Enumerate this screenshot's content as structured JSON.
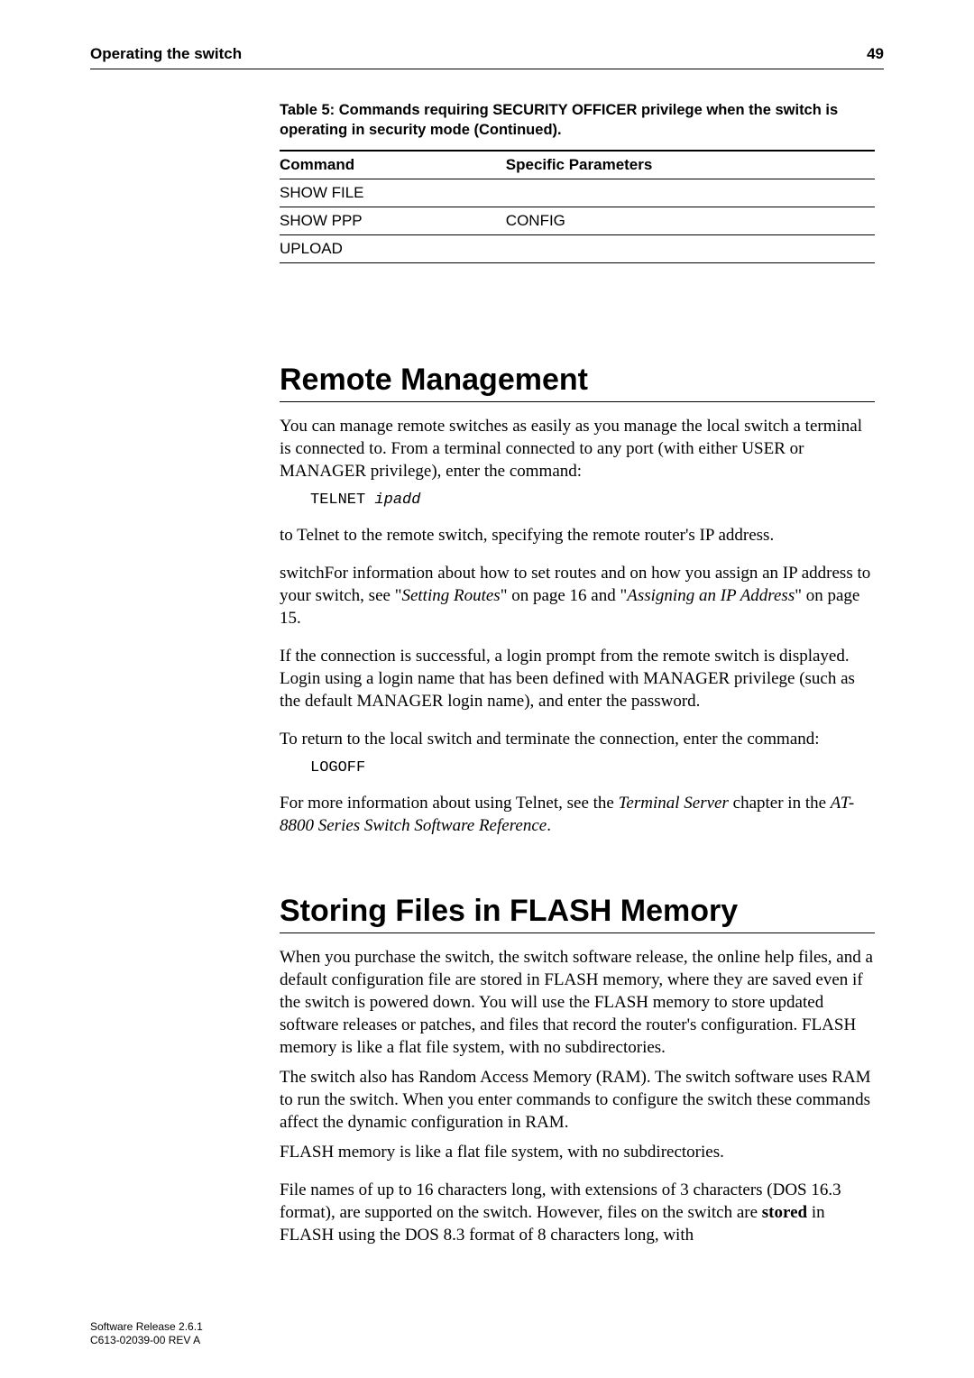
{
  "header": {
    "title": "Operating the switch",
    "page_number": "49"
  },
  "table": {
    "caption": "Table 5: Commands requiring SECURITY OFFICER privilege when the switch is operating in security mode (Continued).",
    "headers": {
      "col1": "Command",
      "col2": "Specific Parameters"
    },
    "rows": [
      {
        "command": "SHOW FILE",
        "params": ""
      },
      {
        "command": "SHOW PPP",
        "params": "CONFIG"
      },
      {
        "command": "UPLOAD",
        "params": ""
      }
    ]
  },
  "section_remote": {
    "title": "Remote Management",
    "p1": "You can manage remote switches as easily as you manage the local switch a terminal is connected to. From a terminal connected to any port (with either USER or MANAGER privilege), enter the command:",
    "cmd1_prefix": "TELNET ",
    "cmd1_arg": "ipadd",
    "p2": "to Telnet to the remote switch, specifying the remote router's IP address.",
    "p3_a": "switchFor information about how to set routes and on how you assign an IP address to your switch, see \"",
    "p3_ref1": "Setting Routes",
    "p3_b": "\" on page 16 and \"",
    "p3_ref2": "Assigning an IP Address",
    "p3_c": "\" on page 15.",
    "p4": "If the connection is successful, a login prompt from the remote switch is displayed. Login using a login name that has been defined with MANAGER privilege (such as the default MANAGER login name), and enter the password.",
    "p5": "To return to the local switch and terminate the connection, enter the command:",
    "cmd2": "LOGOFF",
    "p6_a": "For more information about using Telnet, see the ",
    "p6_ref1": "Terminal Server",
    "p6_b": " chapter in the ",
    "p6_ref2": "AT-8800 Series Switch Software Reference",
    "p6_c": "."
  },
  "section_flash": {
    "title": "Storing Files in FLASH Memory",
    "p1": "When you purchase the switch, the switch software release, the online help files, and a default configuration file are stored in FLASH memory, where they are saved even if the switch is powered down. You will use the FLASH memory to store updated software releases or patches, and files that record the router's configuration. FLASH memory is like a flat file system, with no subdirectories.",
    "p2": "The switch also has Random Access Memory (RAM). The switch software uses RAM to run the switch. When you enter commands to configure the switch these commands affect the dynamic configuration in RAM.",
    "p3": "FLASH memory is like a flat file system, with no subdirectories.",
    "p4_a": "File names of up to 16 characters long, with extensions of 3 characters (DOS 16.3 format), are supported on the switch. However, files on the switch are ",
    "p4_strong": "stored",
    "p4_b": " in FLASH using the DOS 8.3 format of 8 characters long, with"
  },
  "footer": {
    "line1": "Software Release 2.6.1",
    "line2": "C613-02039-00 REV A"
  }
}
